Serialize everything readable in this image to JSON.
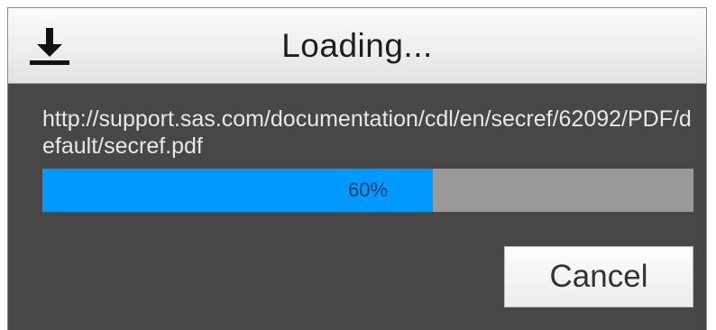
{
  "dialog": {
    "title": "Loading...",
    "download_icon": "download-icon",
    "url": "http://support.sas.com/documentation/cdl/en/secref/62092/PDF/default/secref.pdf",
    "progress": {
      "percent": 60,
      "label": "60%"
    },
    "cancel_label": "Cancel"
  },
  "colors": {
    "dialog_background": "#474747",
    "progress_fill": "#0099ff",
    "progress_track": "#999999"
  }
}
